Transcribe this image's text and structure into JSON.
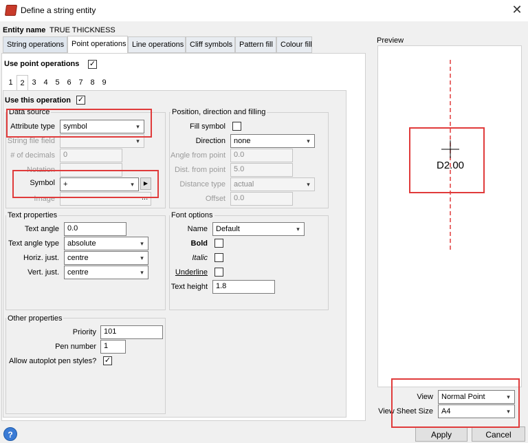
{
  "window": {
    "title": "Define a string entity",
    "close_glyph": "✕"
  },
  "entity": {
    "label": "Entity name",
    "value": "TRUE THICKNESS"
  },
  "tabs": [
    {
      "label": "String operations"
    },
    {
      "label": "Point operations"
    },
    {
      "label": "Line operations"
    },
    {
      "label": "Cliff symbols"
    },
    {
      "label": "Pattern fill"
    },
    {
      "label": "Colour fill"
    }
  ],
  "use_point_ops": {
    "label": "Use point operations",
    "checked": "✓"
  },
  "op_tabs": [
    "1",
    "2",
    "3",
    "4",
    "5",
    "6",
    "7",
    "8",
    "9"
  ],
  "use_this_op": {
    "label": "Use this operation",
    "checked": "✓"
  },
  "data_source": {
    "title": "Data source",
    "attribute_type_label": "Attribute type",
    "attribute_type_value": "symbol",
    "string_file_field_label": "String file field",
    "decimals_label": "# of decimals",
    "decimals_value": "0",
    "notation_label": "Notation",
    "symbol_label": "Symbol",
    "symbol_value": "+",
    "image_label": "Image",
    "image_browse": "..."
  },
  "position": {
    "title": "Position, direction and filling",
    "fill_symbol_label": "Fill symbol",
    "direction_label": "Direction",
    "direction_value": "none",
    "angle_label": "Angle from point",
    "angle_value": "0.0",
    "dist_label": "Dist. from point",
    "dist_value": "5.0",
    "dist_type_label": "Distance type",
    "dist_type_value": "actual",
    "offset_label": "Offset",
    "offset_value": "0.0"
  },
  "text_props": {
    "title": "Text properties",
    "angle_label": "Text angle",
    "angle_value": "0.0",
    "angle_type_label": "Text angle type",
    "angle_type_value": "absolute",
    "horiz_label": "Horiz. just.",
    "horiz_value": "centre",
    "vert_label": "Vert. just.",
    "vert_value": "centre"
  },
  "font_options": {
    "title": "Font options",
    "name_label": "Name",
    "name_value": "Default",
    "bold_label": "Bold",
    "italic_label": "Italic",
    "underline_label": "Underline",
    "height_label": "Text height",
    "height_value": "1.8"
  },
  "other_props": {
    "title": "Other properties",
    "priority_label": "Priority",
    "priority_value": "101",
    "pen_label": "Pen number",
    "pen_value": "1",
    "autoplot_label": "Allow autoplot pen styles?",
    "autoplot_checked": "✓"
  },
  "preview": {
    "title": "Preview",
    "sample_text": "D2.00",
    "view_label": "View",
    "view_value": "Normal Point",
    "sheet_label": "View Sheet Size",
    "sheet_value": "A4"
  },
  "buttons": {
    "help": "?",
    "apply": "Apply",
    "cancel": "Cancel"
  },
  "colors": {
    "highlight": "#e03a3a",
    "preview_line": "#e03a3a"
  }
}
